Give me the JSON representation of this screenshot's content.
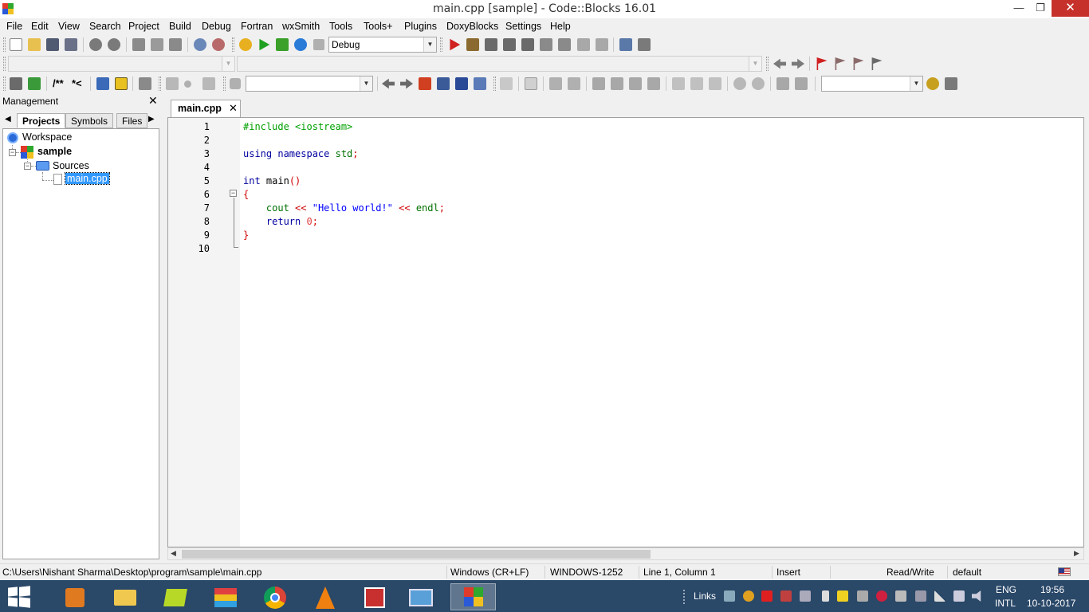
{
  "window": {
    "title": "main.cpp [sample] - Code::Blocks 16.01",
    "minimize": "—",
    "maximize": "❐",
    "close": "✕"
  },
  "menu": [
    "File",
    "Edit",
    "View",
    "Search",
    "Project",
    "Build",
    "Debug",
    "Fortran",
    "wxSmith",
    "Tools",
    "Tools+",
    "Plugins",
    "DoxyBlocks",
    "Settings",
    "Help"
  ],
  "toolbar": {
    "build_target": "Debug",
    "doxy_comment_block": "/**",
    "doxy_comment_line": "*<"
  },
  "management": {
    "title": "Management",
    "close": "✕",
    "tabs": [
      "Projects",
      "Symbols",
      "Files"
    ],
    "tree": {
      "workspace": "Workspace",
      "project": "sample",
      "folder": "Sources",
      "file": "main.cpp"
    }
  },
  "editor": {
    "tab_label": "main.cpp",
    "tab_close": "✕",
    "line_numbers": [
      "1",
      "2",
      "3",
      "4",
      "5",
      "6",
      "7",
      "8",
      "9",
      "10"
    ]
  },
  "status": {
    "path": "C:\\Users\\Nishant Sharma\\Desktop\\program\\sample\\main.cpp",
    "line_endings": "Windows (CR+LF)",
    "encoding": "WINDOWS-1252",
    "position": "Line 1, Column 1",
    "mode": "Insert",
    "access": "Read/Write",
    "profile": "default"
  },
  "taskbar": {
    "links": "Links",
    "lang_top": "ENG",
    "lang_bottom": "INTL",
    "time": "19:56",
    "date": "10-10-2017"
  }
}
